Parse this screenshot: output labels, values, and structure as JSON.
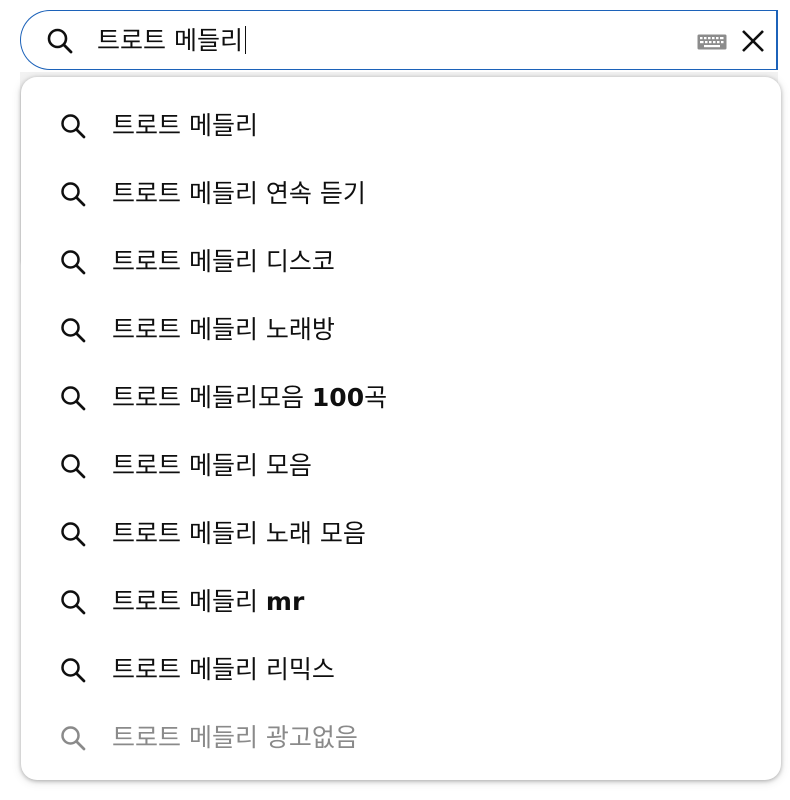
{
  "search": {
    "query": "트로트 메들리",
    "keyboard_icon": "keyboard-icon",
    "clear_icon": "close-icon"
  },
  "suggestions": [
    {
      "typed": "트로트 메들리",
      "rest": "",
      "dim": false
    },
    {
      "typed": "트로트 메들리",
      "rest": " 연속 듣기",
      "dim": false
    },
    {
      "typed": "트로트 메들리",
      "rest": " 디스코",
      "dim": false
    },
    {
      "typed": "트로트 메들리",
      "rest": " 노래방",
      "dim": false
    },
    {
      "typed": "트로트 메들리",
      "rest": "모음 ",
      "bold": "100",
      "tail": "곡",
      "dim": false
    },
    {
      "typed": "트로트 메들리",
      "rest": " 모음",
      "dim": false
    },
    {
      "typed": "트로트 메들리",
      "rest": " 노래 모음",
      "dim": false
    },
    {
      "typed": "트로트 메들리",
      "rest": " ",
      "bold": "mr",
      "tail": "",
      "dim": false
    },
    {
      "typed": "트로트 메들리",
      "rest": " 리믹스",
      "dim": false
    },
    {
      "typed": "트로트 메들리",
      "rest": " 광고없음",
      "dim": true
    }
  ]
}
